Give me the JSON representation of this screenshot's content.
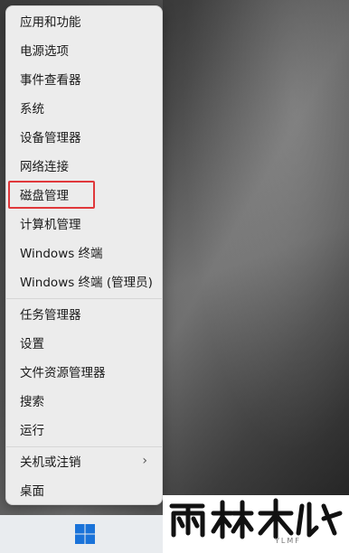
{
  "menu": {
    "items": [
      {
        "label": "应用和功能"
      },
      {
        "label": "电源选项"
      },
      {
        "label": "事件查看器"
      },
      {
        "label": "系统"
      },
      {
        "label": "设备管理器"
      },
      {
        "label": "网络连接"
      },
      {
        "label": "磁盘管理",
        "highlighted": true
      },
      {
        "label": "计算机管理"
      },
      {
        "label": "Windows 终端"
      },
      {
        "label": "Windows 终端 (管理员)"
      },
      {
        "label": "任务管理器"
      },
      {
        "label": "设置"
      },
      {
        "label": "文件资源管理器"
      },
      {
        "label": "搜索"
      },
      {
        "label": "运行"
      },
      {
        "label": "关机或注销",
        "submenu_arrow": "›"
      },
      {
        "label": "桌面"
      }
    ],
    "highlight_color": "#e0383b"
  },
  "taskbar": {
    "start_icon": "windows-logo-icon",
    "accent_color": "#1a73d9"
  },
  "watermark": {
    "logo": "雨林木风",
    "sub": "YLMF"
  }
}
